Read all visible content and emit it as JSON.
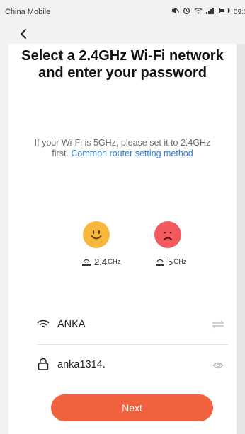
{
  "status_bar": {
    "carrier": "China Mobile",
    "indicators": [
      "mute-icon",
      "alarm-icon",
      "wifi-icon",
      "signal-icon",
      "battery-icon"
    ],
    "time": "09:3"
  },
  "header": {
    "title": "Select a 2.4GHz Wi-Fi network and enter your password"
  },
  "hint": {
    "text": "If your Wi-Fi is 5GHz, please set it to 2.4GHz first. ",
    "link": "Common router setting method"
  },
  "bands": [
    {
      "value": "2.4",
      "unit": "GHz",
      "face": "smile-icon",
      "color": "#f7b73c"
    },
    {
      "value": "5",
      "unit": "GHz",
      "face": "frown-icon",
      "color": "#f25a5e"
    }
  ],
  "network": {
    "ssid": "ANKA",
    "password": "anka1314."
  },
  "actions": {
    "next_label": "Next"
  },
  "colors": {
    "accent": "#f0613e",
    "link": "#2a7fd5"
  }
}
